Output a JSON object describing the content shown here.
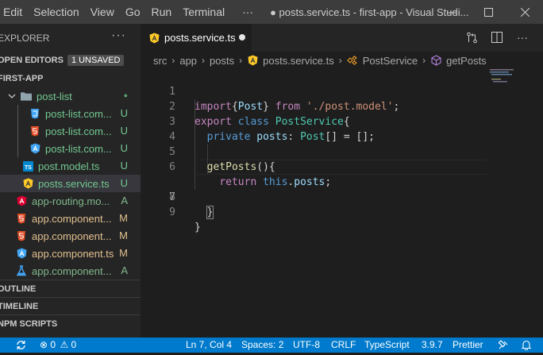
{
  "menu": [
    "Edit",
    "Selection",
    "View",
    "Go",
    "Run",
    "Terminal",
    "···"
  ],
  "window_title": "● posts.service.ts - first-app - Visual Studi...",
  "explorer": {
    "header": "EXPLORER",
    "open_editors": "OPEN EDITORS",
    "unsaved_badge": "1 UNSAVED",
    "project": "FIRST-APP",
    "items": [
      {
        "label": "post-list",
        "status": "●",
        "icon": "folder-icon"
      },
      {
        "label": "post-list.com...",
        "status": "U",
        "icon": "css-file-icon"
      },
      {
        "label": "post-list.com...",
        "status": "U",
        "icon": "html-file-icon"
      },
      {
        "label": "post-list.com...",
        "status": "U",
        "icon": "angular-ts-file-icon"
      },
      {
        "label": "post.model.ts",
        "status": "U",
        "icon": "typescript-file-icon"
      },
      {
        "label": "posts.service.ts",
        "status": "U",
        "icon": "angular-service-file-icon"
      },
      {
        "label": "app-routing.mo...",
        "status": "A",
        "icon": "angular-routing-file-icon"
      },
      {
        "label": "app.component...",
        "status": "M",
        "icon": "html-file-icon"
      },
      {
        "label": "app.component...",
        "status": "M",
        "icon": "html-file-icon"
      },
      {
        "label": "app.component.ts",
        "status": "M",
        "icon": "angular-ts-file-icon"
      },
      {
        "label": "app.component...",
        "status": "A",
        "icon": "test-file-icon"
      }
    ],
    "outline": "OUTLINE",
    "timeline": "TIMELINE",
    "npm_scripts": "NPM SCRIPTS"
  },
  "tab": {
    "label": "posts.service.ts"
  },
  "breadcrumb": {
    "src": "src",
    "app": "app",
    "posts": "posts",
    "file": "posts.service.ts",
    "class": "PostService",
    "method": "getPosts"
  },
  "code": {
    "line_numbers": [
      "1",
      "2",
      "3",
      "4",
      "5",
      "6",
      "7",
      "8",
      "9"
    ],
    "current_line": 7,
    "l1": {
      "kw": "import",
      "p1": "{",
      "cls": "Post",
      "p2": "} ",
      "kw2": "from",
      "sp": " ",
      "str": "'./post.model'",
      "end": ";"
    },
    "l2": {
      "kw": "export",
      "kw2": "class",
      "cls": "PostService",
      "end": "{"
    },
    "l3": {
      "kw": "private",
      "var": "posts",
      "p1": ": ",
      "cls": "Post",
      "end": "[] = [];"
    },
    "l5": {
      "fn": "getPosts",
      "end": "(){"
    },
    "l6": {
      "kw": "return",
      "kw2": "this",
      "dot": ".",
      "var": "posts",
      "end": ";"
    },
    "l7": {
      "end": "}"
    },
    "l9": {
      "end": "}"
    }
  },
  "status": {
    "errors": "0",
    "warnings": "0",
    "position": "Ln 7, Col 4",
    "spaces": "Spaces: 2",
    "encoding": "UTF-8",
    "eol": "CRLF",
    "language": "TypeScript",
    "version": "3.9.7",
    "formatter": "Prettier"
  },
  "colors": {
    "accent": "#007acc",
    "angular": "#dd0031",
    "folder_git": "#73c991",
    "untracked": "#73c991",
    "modified": "#e2c08d",
    "added": "#81b88b"
  }
}
